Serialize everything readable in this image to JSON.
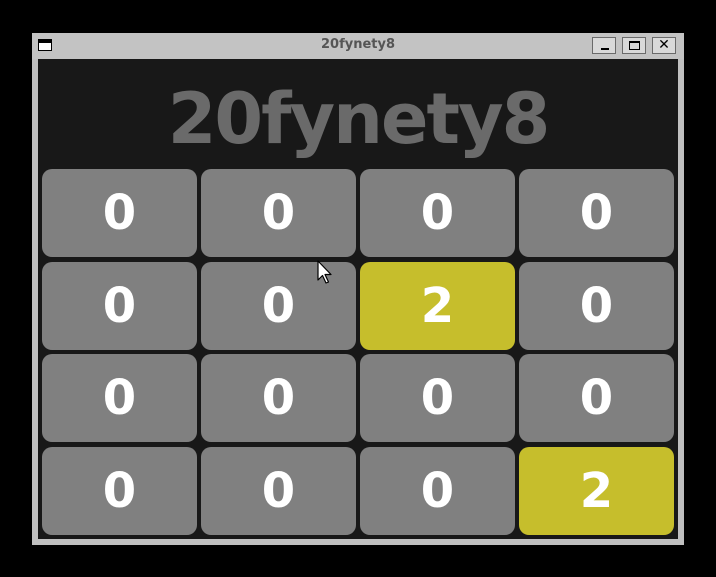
{
  "window": {
    "title": "20fynety8",
    "close_glyph": "✕"
  },
  "game": {
    "heading": "20fynety8",
    "tile_color": "#808080",
    "highlight_color": "#c6be2c",
    "board": [
      [
        "0",
        "0",
        "0",
        "0"
      ],
      [
        "0",
        "0",
        "2",
        "0"
      ],
      [
        "0",
        "0",
        "0",
        "0"
      ],
      [
        "0",
        "0",
        "0",
        "2"
      ]
    ]
  }
}
